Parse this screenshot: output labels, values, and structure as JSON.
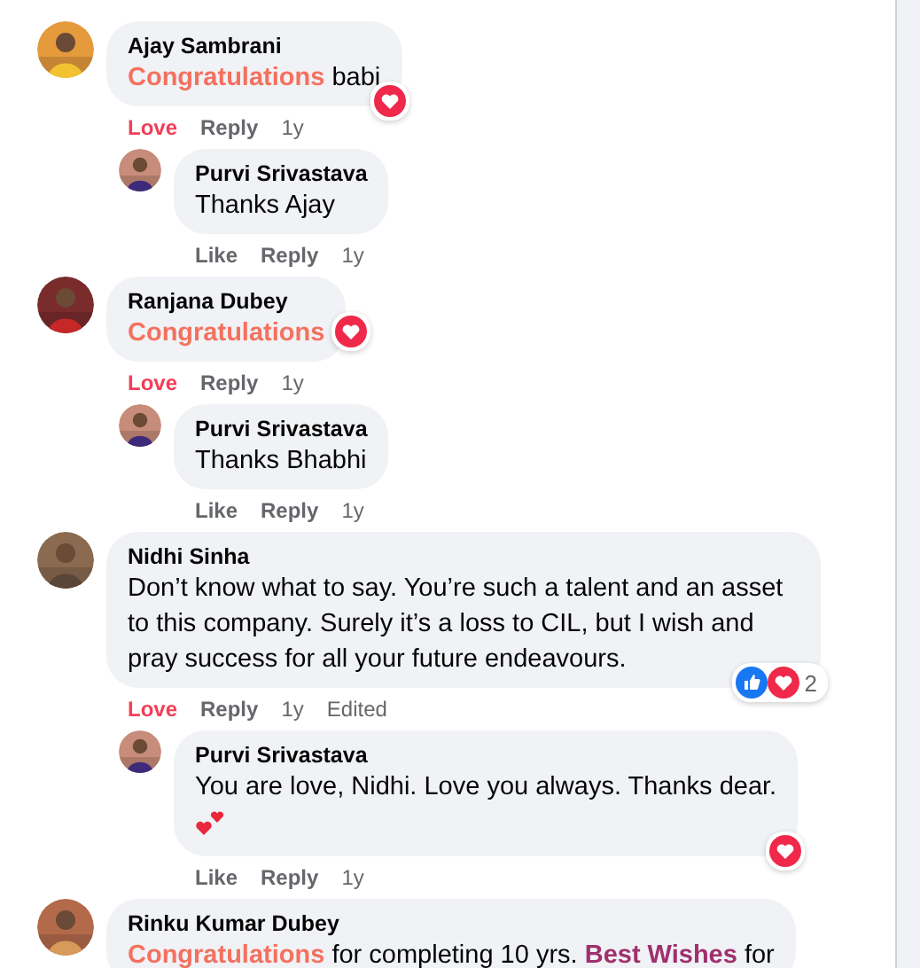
{
  "comments": [
    {
      "author": "Ajay Sambrani",
      "body": [
        {
          "kind": "tag",
          "text": "Congratulations",
          "color": "#f4715f"
        },
        {
          "kind": "plain",
          "text": " babi"
        }
      ],
      "reactions": {
        "kind": "corner",
        "items": [
          {
            "kind": "love"
          }
        ]
      },
      "actions": [
        {
          "kind": "reaction",
          "label": "Love",
          "active": true
        },
        {
          "kind": "link",
          "label": "Reply"
        },
        {
          "kind": "time",
          "label": "1y"
        }
      ],
      "replies": [
        {
          "author": "Purvi Srivastava",
          "body": [
            {
              "kind": "plain",
              "text": "Thanks Ajay"
            }
          ],
          "actions": [
            {
              "kind": "reaction",
              "label": "Like",
              "active": false
            },
            {
              "kind": "link",
              "label": "Reply"
            },
            {
              "kind": "time",
              "label": "1y"
            }
          ]
        }
      ]
    },
    {
      "author": "Ranjana Dubey",
      "body": [
        {
          "kind": "tag",
          "text": "Congratulations",
          "color": "#f4715f"
        }
      ],
      "reactions": {
        "kind": "side",
        "items": [
          {
            "kind": "love"
          }
        ]
      },
      "actions": [
        {
          "kind": "reaction",
          "label": "Love",
          "active": true
        },
        {
          "kind": "link",
          "label": "Reply"
        },
        {
          "kind": "time",
          "label": "1y"
        }
      ],
      "replies": [
        {
          "author": "Purvi Srivastava",
          "body": [
            {
              "kind": "plain",
              "text": "Thanks Bhabhi"
            }
          ],
          "actions": [
            {
              "kind": "reaction",
              "label": "Like",
              "active": false
            },
            {
              "kind": "link",
              "label": "Reply"
            },
            {
              "kind": "time",
              "label": "1y"
            }
          ]
        }
      ]
    },
    {
      "author": "Nidhi Sinha",
      "body": [
        {
          "kind": "plain",
          "text": "Don’t know what to say. You’re such a talent and an asset to this company. Surely it’s a loss to CIL, but I wish and pray success for all your future endeavours."
        }
      ],
      "reactions": {
        "kind": "corner",
        "items": [
          {
            "kind": "like"
          },
          {
            "kind": "love"
          }
        ],
        "count": "2"
      },
      "actions": [
        {
          "kind": "reaction",
          "label": "Love",
          "active": true
        },
        {
          "kind": "link",
          "label": "Reply"
        },
        {
          "kind": "time",
          "label": "1y"
        },
        {
          "kind": "time",
          "label": "Edited"
        }
      ],
      "replies": [
        {
          "author": "Purvi Srivastava",
          "body": [
            {
              "kind": "plain",
              "text": "You are love, Nidhi. Love you always. Thanks dear."
            },
            {
              "kind": "hearts"
            }
          ],
          "reactions": {
            "kind": "corner",
            "items": [
              {
                "kind": "love"
              }
            ]
          },
          "actions": [
            {
              "kind": "reaction",
              "label": "Like",
              "active": false
            },
            {
              "kind": "link",
              "label": "Reply"
            },
            {
              "kind": "time",
              "label": "1y"
            }
          ]
        }
      ]
    },
    {
      "author": "Rinku Kumar Dubey",
      "body": [
        {
          "kind": "tag",
          "text": "Congratulations",
          "color": "#f4715f"
        },
        {
          "kind": "plain",
          "text": " for completing 10 yrs. "
        },
        {
          "kind": "tag",
          "text": "Best Wishes",
          "color": "#a0306e"
        },
        {
          "kind": "plain",
          "text": " for"
        }
      ]
    }
  ]
}
